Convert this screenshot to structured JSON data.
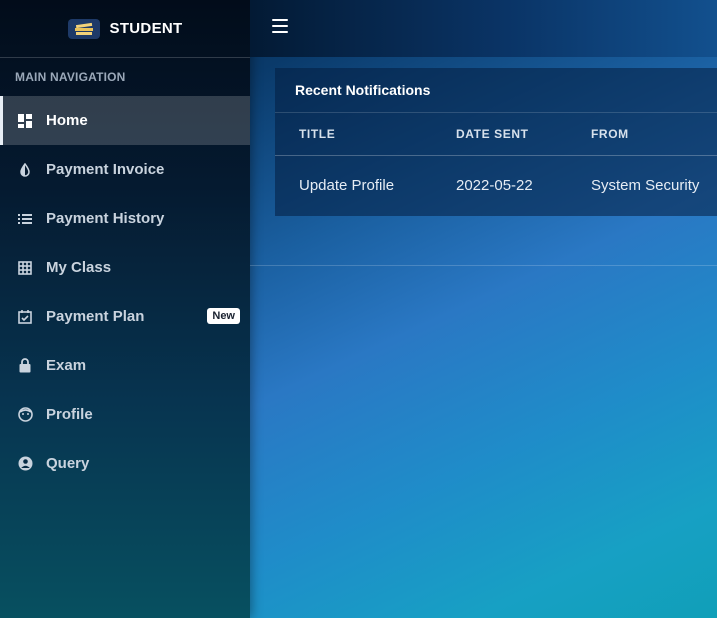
{
  "brand": {
    "name": "STUDENT",
    "logo_icon": "books-icon"
  },
  "nav": {
    "header": "MAIN NAVIGATION",
    "items": [
      {
        "label": "Home",
        "icon": "dashboard-icon",
        "active": true
      },
      {
        "label": "Payment Invoice",
        "icon": "contrast-icon"
      },
      {
        "label": "Payment History",
        "icon": "list-icon"
      },
      {
        "label": "My Class",
        "icon": "grid-icon"
      },
      {
        "label": "Payment Plan",
        "icon": "calendar-check-icon",
        "badge": "New"
      },
      {
        "label": "Exam",
        "icon": "lock-icon"
      },
      {
        "label": "Profile",
        "icon": "face-icon"
      },
      {
        "label": "Query",
        "icon": "account-circle-icon"
      }
    ]
  },
  "topbar": {
    "menu_icon": "hamburger-icon"
  },
  "notifications": {
    "title": "Recent Notifications",
    "columns": [
      "TITLE",
      "DATE SENT",
      "FROM"
    ],
    "rows": [
      [
        "Update Profile",
        "2022-05-22",
        "System Security"
      ]
    ]
  },
  "colors": {
    "sidebar_top": "#020c1a",
    "sidebar_bottom": "#075060",
    "content_accent": "#2a78c4",
    "badge_bg": "#ffffff"
  }
}
